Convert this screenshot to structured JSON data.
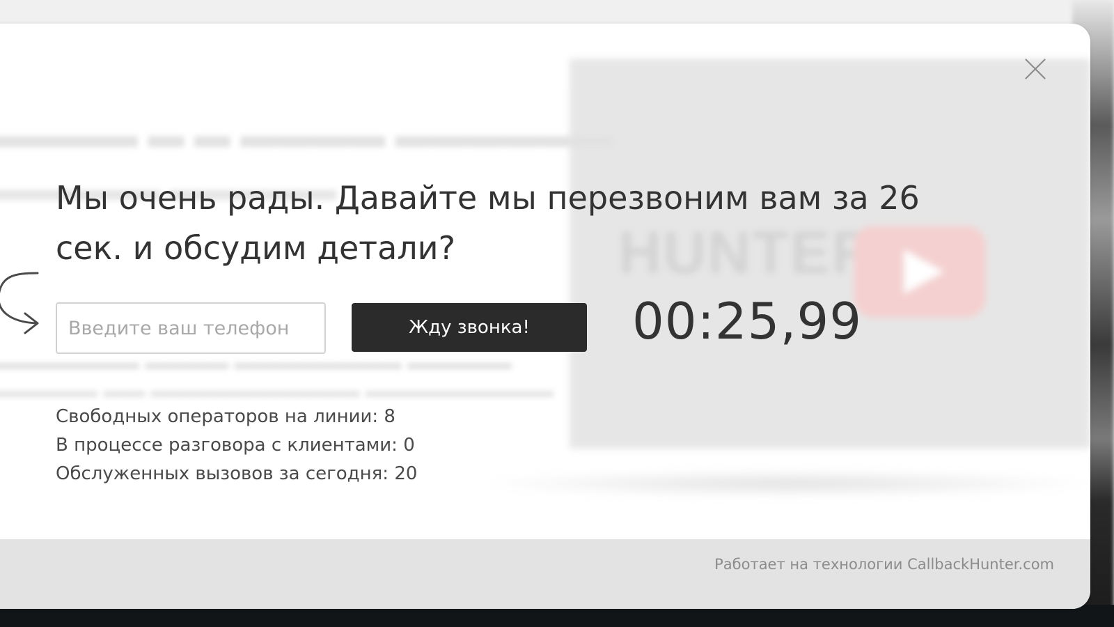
{
  "popup": {
    "heading": "Мы очень рады. Давайте мы перезвоним вам за 26 сек. и обсудим детали?",
    "phone_placeholder": "Введите ваш телефон",
    "phone_value": "",
    "call_button_label": "Жду звонка!",
    "timer": "00:25,99",
    "stats": [
      "Свободных операторов на линии: 8",
      "В процессе разговора с клиентами: 0",
      "Обслуженных вызовов за сегодня: 20"
    ],
    "footer_text": "Работает на технологии CallbackHunter.com"
  },
  "icons": {
    "close": "close-icon",
    "arrow": "curved-arrow-icon"
  },
  "colors": {
    "button_bg": "#2b2b2b",
    "button_text": "#ffffff",
    "text": "#333333",
    "footer_bg": "#e3e3e3",
    "footer_text": "#8c8c8c"
  }
}
